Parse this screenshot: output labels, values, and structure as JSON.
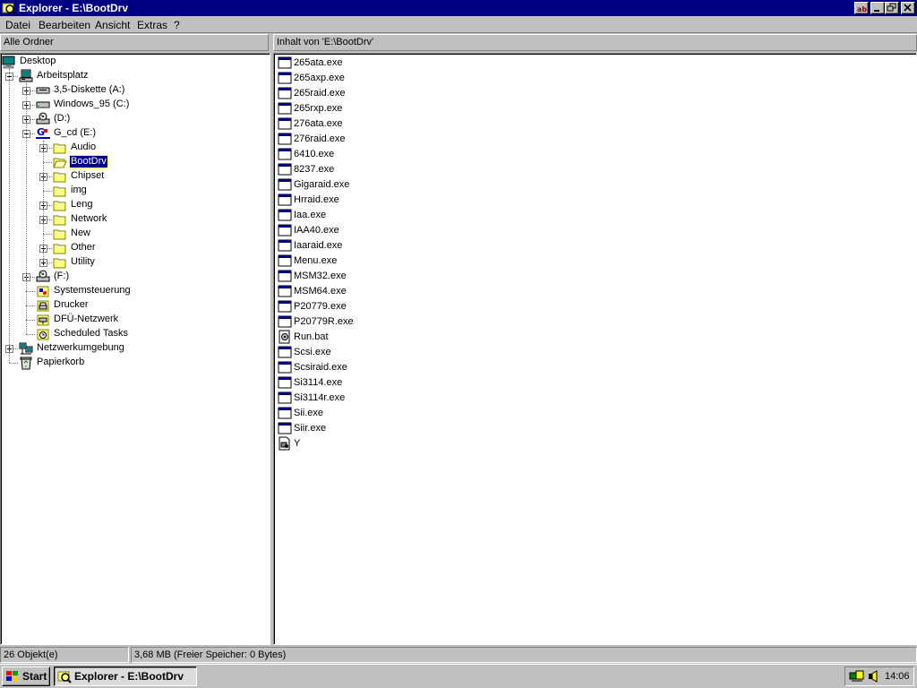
{
  "window": {
    "title": "Explorer - E:\\BootDrv",
    "buttons": [
      "help",
      "minimize",
      "restore",
      "close"
    ]
  },
  "menu": [
    "Datei",
    "Bearbeiten",
    "Ansicht",
    "Extras",
    "?"
  ],
  "tree_header": "Alle Ordner",
  "content_header": "Inhalt von 'E:\\BootDrv'",
  "tree": [
    {
      "label": "Desktop",
      "icon": "desktop-icon",
      "level": 0,
      "expander": "none"
    },
    {
      "label": "Arbeitsplatz",
      "icon": "computer-icon",
      "level": 1,
      "expander": "minus"
    },
    {
      "label": "3,5-Diskette (A:)",
      "icon": "floppy-drive-icon",
      "level": 2,
      "expander": "plus"
    },
    {
      "label": "Windows_95 (C:)",
      "icon": "hard-drive-icon",
      "level": 2,
      "expander": "plus"
    },
    {
      "label": "(D:)",
      "icon": "cd-drive-icon",
      "level": 2,
      "expander": "plus"
    },
    {
      "label": "G_cd (E:)",
      "icon": "gigabyte-cd-icon",
      "level": 2,
      "expander": "minus"
    },
    {
      "label": "Audio",
      "icon": "folder-icon",
      "level": 3,
      "expander": "plus"
    },
    {
      "label": "BootDrv",
      "icon": "open-folder-icon",
      "level": 3,
      "expander": "none",
      "selected": true
    },
    {
      "label": "Chipset",
      "icon": "folder-icon",
      "level": 3,
      "expander": "plus"
    },
    {
      "label": "img",
      "icon": "folder-icon",
      "level": 3,
      "expander": "none"
    },
    {
      "label": "Leng",
      "icon": "folder-icon",
      "level": 3,
      "expander": "plus"
    },
    {
      "label": "Network",
      "icon": "folder-icon",
      "level": 3,
      "expander": "plus"
    },
    {
      "label": "New",
      "icon": "folder-icon",
      "level": 3,
      "expander": "none"
    },
    {
      "label": "Other",
      "icon": "folder-icon",
      "level": 3,
      "expander": "plus"
    },
    {
      "label": "Utility",
      "icon": "folder-icon",
      "level": 3,
      "expander": "plus"
    },
    {
      "label": "(F:)",
      "icon": "cd-drive-icon",
      "level": 2,
      "expander": "plus"
    },
    {
      "label": "Systemsteuerung",
      "icon": "control-panel-icon",
      "level": 2,
      "expander": "none"
    },
    {
      "label": "Drucker",
      "icon": "printers-icon",
      "level": 2,
      "expander": "none"
    },
    {
      "label": "DFÜ-Netzwerk",
      "icon": "dialup-network-icon",
      "level": 2,
      "expander": "none"
    },
    {
      "label": "Scheduled Tasks",
      "icon": "scheduled-tasks-icon",
      "level": 2,
      "expander": "none"
    },
    {
      "label": "Netzwerkumgebung",
      "icon": "network-neighborhood-icon",
      "level": 1,
      "expander": "plus"
    },
    {
      "label": "Papierkorb",
      "icon": "recycle-bin-icon",
      "level": 1,
      "expander": "none"
    }
  ],
  "files": [
    {
      "name": "265ata.exe",
      "icon": "exe-icon"
    },
    {
      "name": "265axp.exe",
      "icon": "exe-icon"
    },
    {
      "name": "265raid.exe",
      "icon": "exe-icon"
    },
    {
      "name": "265rxp.exe",
      "icon": "exe-icon"
    },
    {
      "name": "276ata.exe",
      "icon": "exe-icon"
    },
    {
      "name": "276raid.exe",
      "icon": "exe-icon"
    },
    {
      "name": "6410.exe",
      "icon": "exe-icon"
    },
    {
      "name": "8237.exe",
      "icon": "exe-icon"
    },
    {
      "name": "Gigaraid.exe",
      "icon": "exe-icon"
    },
    {
      "name": "Hrraid.exe",
      "icon": "exe-icon"
    },
    {
      "name": "Iaa.exe",
      "icon": "exe-icon"
    },
    {
      "name": "IAA40.exe",
      "icon": "exe-icon"
    },
    {
      "name": "Iaaraid.exe",
      "icon": "exe-icon"
    },
    {
      "name": "Menu.exe",
      "icon": "exe-icon"
    },
    {
      "name": "MSM32.exe",
      "icon": "exe-icon"
    },
    {
      "name": "MSM64.exe",
      "icon": "exe-icon"
    },
    {
      "name": "P20779.exe",
      "icon": "exe-icon"
    },
    {
      "name": "P20779R.exe",
      "icon": "exe-icon"
    },
    {
      "name": "Run.bat",
      "icon": "batch-file-icon"
    },
    {
      "name": "Scsi.exe",
      "icon": "exe-icon"
    },
    {
      "name": "Scsiraid.exe",
      "icon": "exe-icon"
    },
    {
      "name": "Si3114.exe",
      "icon": "exe-icon"
    },
    {
      "name": "Si3114r.exe",
      "icon": "exe-icon"
    },
    {
      "name": "Sii.exe",
      "icon": "exe-icon"
    },
    {
      "name": "Siir.exe",
      "icon": "exe-icon"
    },
    {
      "name": "Y",
      "icon": "system-file-icon"
    }
  ],
  "status": {
    "count": "26 Objekt(e)",
    "size": "3,68 MB (Freier Speicher: 0 Bytes)"
  },
  "taskbar": {
    "start": "Start",
    "task": "Explorer - E:\\BootDrv",
    "clock": "14:06"
  },
  "colors": {
    "title_bg": "#000080",
    "face": "#c0c0c0",
    "selection": "#000080",
    "folder": "#ffff80"
  }
}
